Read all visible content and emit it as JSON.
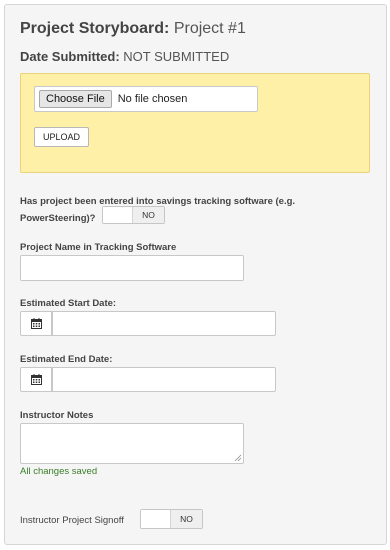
{
  "header": {
    "title_bold": "Project Storyboard:",
    "project_name": "Project #1",
    "date_label": "Date Submitted:",
    "date_value": "NOT SUBMITTED"
  },
  "upload": {
    "choose_file_label": "Choose File",
    "file_status": "No file chosen",
    "upload_button_label": "UPLOAD"
  },
  "tracking_question": {
    "label": "Has project been entered into savings tracking software (e.g. PowerSteering)?",
    "toggle_state": "NO"
  },
  "fields": {
    "project_name_label": "Project Name in Tracking Software",
    "project_name_value": "",
    "start_date_label": "Estimated Start Date:",
    "start_date_value": "",
    "end_date_label": "Estimated End Date:",
    "end_date_value": "",
    "instructor_notes_label": "Instructor Notes",
    "instructor_notes_value": ""
  },
  "status": {
    "saved_text": "All changes saved"
  },
  "signoff": {
    "label": "Instructor Project Signoff",
    "toggle_state": "NO"
  },
  "icons": {
    "calendar": "calendar-icon"
  },
  "colors": {
    "panel_bg": "#f5f5f5",
    "upload_box_bg": "#fff0a8",
    "saved_text": "#3a7d2a"
  }
}
